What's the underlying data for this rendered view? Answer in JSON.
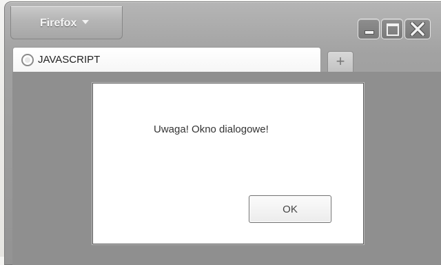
{
  "window": {
    "app_button_label": "Firefox",
    "controls": [
      "minimize",
      "maximize",
      "close"
    ]
  },
  "tabs": [
    {
      "label": "JAVASCRIPT",
      "icon": "loading-spinner-icon"
    }
  ],
  "new_tab_symbol": "+",
  "dialog": {
    "message": "Uwaga! Okno dialogowe!",
    "ok_label": "OK"
  },
  "colors": {
    "chrome": "#a2a2a2",
    "content_bg": "#8f8f8f",
    "dialog_bg": "#ffffff"
  }
}
